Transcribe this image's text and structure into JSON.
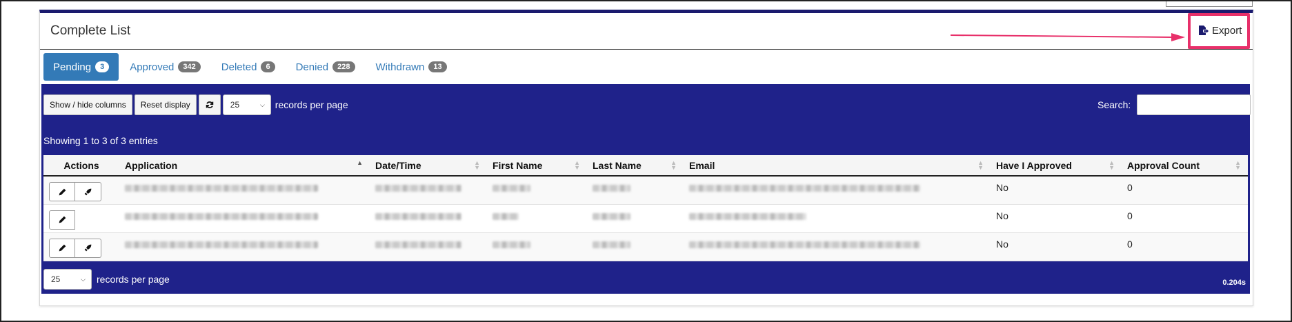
{
  "panel": {
    "title": "Complete List",
    "export_label": "Export"
  },
  "tabs": [
    {
      "label": "Pending",
      "count": "3"
    },
    {
      "label": "Approved",
      "count": "342"
    },
    {
      "label": "Deleted",
      "count": "6"
    },
    {
      "label": "Denied",
      "count": "228"
    },
    {
      "label": "Withdrawn",
      "count": "13"
    }
  ],
  "toolbar": {
    "show_hide_label": "Show / hide columns",
    "reset_label": "Reset display",
    "page_size": "25",
    "rpp_label": "records per page",
    "search_label": "Search:"
  },
  "info": "Showing 1 to 3 of 3 entries",
  "columns": [
    "Actions",
    "Application",
    "Date/Time",
    "First Name",
    "Last Name",
    "Email",
    "Have I Approved",
    "Approval Count"
  ],
  "rows": [
    {
      "have_approved": "No",
      "approval_count": "0"
    },
    {
      "have_approved": "No",
      "approval_count": "0"
    },
    {
      "have_approved": "No",
      "approval_count": "0"
    }
  ],
  "footer": {
    "page_size": "25",
    "rpp_label": "records per page",
    "timing": "0.204s"
  },
  "colors": {
    "accent": "#337ab7",
    "table_bg": "#1f228a",
    "highlight": "#e8306a"
  }
}
